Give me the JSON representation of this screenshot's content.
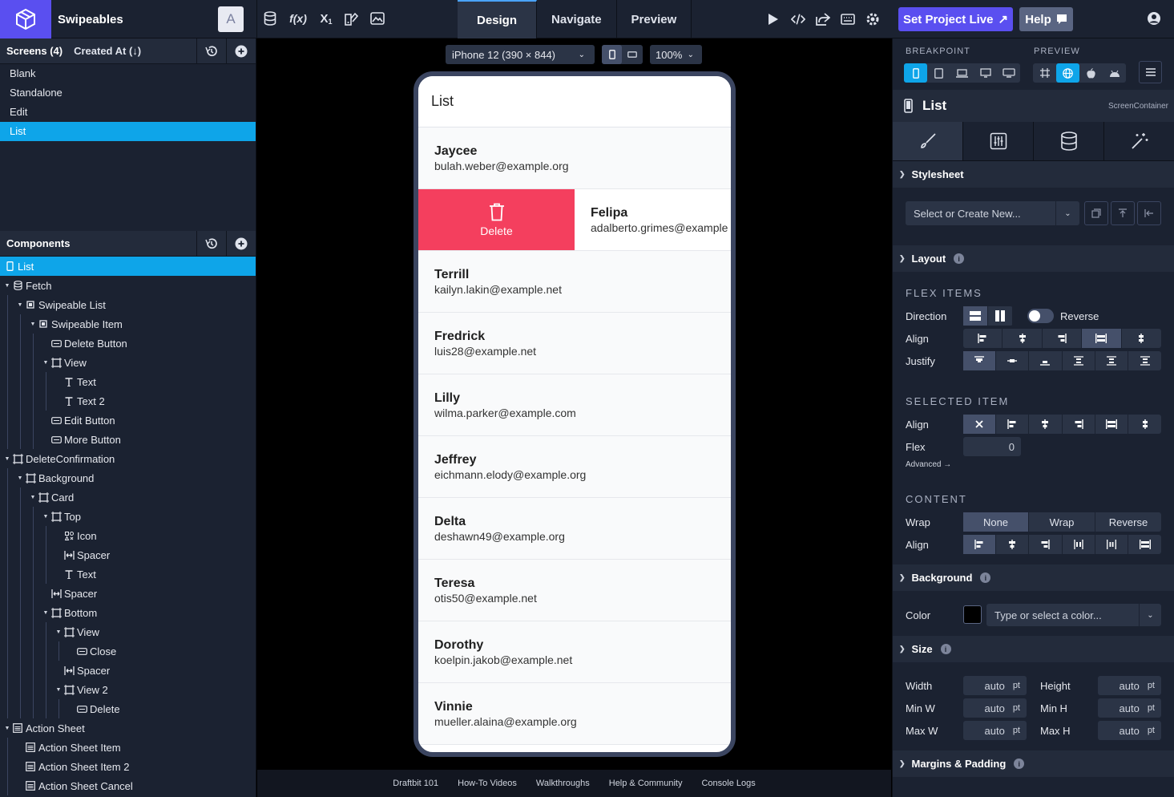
{
  "app": {
    "project_name": "Swipeables",
    "avatar_letter": "A"
  },
  "mode_tabs": [
    "Design",
    "Navigate",
    "Preview"
  ],
  "actions": {
    "set_live": "Set Project Live",
    "help": "Help"
  },
  "screens": {
    "title": "Screens (4)",
    "sort": "Created At (↓)",
    "items": [
      "Blank",
      "Standalone",
      "Edit",
      "List"
    ],
    "selected": "List"
  },
  "components": {
    "title": "Components",
    "tree": [
      {
        "label": "List",
        "depth": 0,
        "icon": "phone-icon",
        "toggle": "",
        "active": true
      },
      {
        "label": "Fetch",
        "depth": 0,
        "icon": "database-icon",
        "toggle": "▼"
      },
      {
        "label": "Swipeable List",
        "depth": 1,
        "icon": "list-block-icon",
        "toggle": "▼"
      },
      {
        "label": "Swipeable Item",
        "depth": 2,
        "icon": "list-block-icon",
        "toggle": "▼"
      },
      {
        "label": "Delete Button",
        "depth": 3,
        "icon": "button-icon",
        "toggle": ""
      },
      {
        "label": "View",
        "depth": 3,
        "icon": "view-icon",
        "toggle": "▼"
      },
      {
        "label": "Text",
        "depth": 4,
        "icon": "text-icon",
        "toggle": ""
      },
      {
        "label": "Text 2",
        "depth": 4,
        "icon": "text-icon",
        "toggle": ""
      },
      {
        "label": "Edit Button",
        "depth": 3,
        "icon": "button-icon",
        "toggle": ""
      },
      {
        "label": "More Button",
        "depth": 3,
        "icon": "button-icon",
        "toggle": ""
      },
      {
        "label": "DeleteConfirmation",
        "depth": 0,
        "icon": "view-icon",
        "toggle": "▼"
      },
      {
        "label": "Background",
        "depth": 1,
        "icon": "view-icon",
        "toggle": "▼"
      },
      {
        "label": "Card",
        "depth": 2,
        "icon": "view-icon",
        "toggle": "▼"
      },
      {
        "label": "Top",
        "depth": 3,
        "icon": "view-icon",
        "toggle": "▼"
      },
      {
        "label": "Icon",
        "depth": 4,
        "icon": "icon-icon",
        "toggle": ""
      },
      {
        "label": "Spacer",
        "depth": 4,
        "icon": "spacer-icon",
        "toggle": ""
      },
      {
        "label": "Text",
        "depth": 4,
        "icon": "text-icon",
        "toggle": ""
      },
      {
        "label": "Spacer",
        "depth": 3,
        "icon": "spacer-icon",
        "toggle": ""
      },
      {
        "label": "Bottom",
        "depth": 3,
        "icon": "view-icon",
        "toggle": "▼"
      },
      {
        "label": "View",
        "depth": 4,
        "icon": "view-icon",
        "toggle": "▼"
      },
      {
        "label": "Close",
        "depth": 5,
        "icon": "button-icon",
        "toggle": ""
      },
      {
        "label": "Spacer",
        "depth": 4,
        "icon": "spacer-icon",
        "toggle": ""
      },
      {
        "label": "View 2",
        "depth": 4,
        "icon": "view-icon",
        "toggle": "▼"
      },
      {
        "label": "Delete",
        "depth": 5,
        "icon": "button-icon",
        "toggle": ""
      },
      {
        "label": "Action Sheet",
        "depth": 0,
        "icon": "action-sheet-icon",
        "toggle": "▼"
      },
      {
        "label": "Action Sheet Item",
        "depth": 1,
        "icon": "action-sheet-icon",
        "toggle": ""
      },
      {
        "label": "Action Sheet Item 2",
        "depth": 1,
        "icon": "action-sheet-icon",
        "toggle": ""
      },
      {
        "label": "Action Sheet Cancel",
        "depth": 1,
        "icon": "action-sheet-icon",
        "toggle": ""
      }
    ]
  },
  "canvas": {
    "device": "iPhone 12 (390 × 844)",
    "zoom": "100%",
    "screen_title": "List",
    "delete_label": "Delete",
    "items": [
      {
        "name": "Jaycee",
        "email": "bulah.weber@example.org"
      },
      {
        "name": "Felipa",
        "email": "adalberto.grimes@example",
        "swiped": true
      },
      {
        "name": "Terrill",
        "email": "kailyn.lakin@example.net"
      },
      {
        "name": "Fredrick",
        "email": "luis28@example.net"
      },
      {
        "name": "Lilly",
        "email": "wilma.parker@example.com"
      },
      {
        "name": "Jeffrey",
        "email": "eichmann.elody@example.org"
      },
      {
        "name": "Delta",
        "email": "deshawn49@example.org"
      },
      {
        "name": "Teresa",
        "email": "otis50@example.net"
      },
      {
        "name": "Dorothy",
        "email": "koelpin.jakob@example.net"
      },
      {
        "name": "Vinnie",
        "email": "mueller.alaina@example.org"
      }
    ]
  },
  "footer_links": [
    "Draftbit 101",
    "How-To Videos",
    "Walkthroughs",
    "Help & Community",
    "Console Logs"
  ],
  "inspector": {
    "breakpoint_label": "BREAKPOINT",
    "preview_label": "PREVIEW",
    "selected_name": "List",
    "selected_type": "ScreenContainer",
    "stylesheet": {
      "title": "Stylesheet",
      "placeholder": "Select or Create New..."
    },
    "layout": {
      "title": "Layout",
      "flex_items": "FLEX ITEMS",
      "direction": "Direction",
      "reverse": "Reverse",
      "align": "Align",
      "justify": "Justify",
      "selected_item": "SELECTED ITEM",
      "flex": "Flex",
      "flex_value": "0",
      "advanced": "Advanced →",
      "content": "CONTENT",
      "wrap": "Wrap",
      "wrap_options": [
        "None",
        "Wrap",
        "Reverse"
      ]
    },
    "background": {
      "title": "Background",
      "color_label": "Color",
      "color_placeholder": "Type or select a color...",
      "color_value": "#000000"
    },
    "size": {
      "title": "Size",
      "width": "Width",
      "height": "Height",
      "min_w": "Min W",
      "min_h": "Min H",
      "max_w": "Max W",
      "max_h": "Max H",
      "auto": "auto",
      "unit": "pt"
    },
    "margins": {
      "title": "Margins & Padding"
    }
  },
  "colors": {
    "accent": "#5a4ff0",
    "selection": "#0ea5e9",
    "delete": "#f43f5e"
  }
}
